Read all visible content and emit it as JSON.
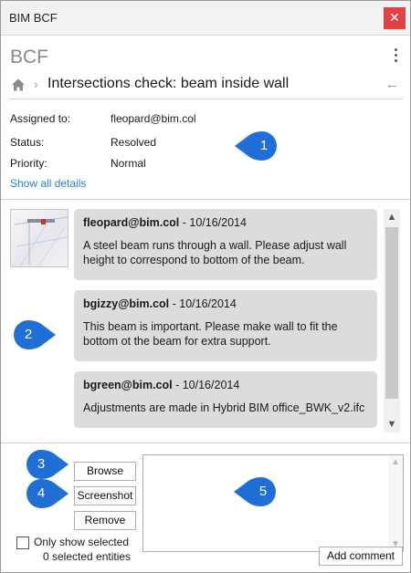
{
  "window": {
    "title": "BIM BCF",
    "close_glyph": "✕"
  },
  "header": {
    "app_name": "BCF"
  },
  "nav": {
    "title": "Intersections check: beam inside wall",
    "chevron": "›",
    "back_glyph": "←"
  },
  "details": {
    "assigned_label": "Assigned to:",
    "assigned_value": "fleopard@bim.col",
    "status_label": "Status:",
    "status_value": "Resolved",
    "priority_label": "Priority:",
    "priority_value": "Normal",
    "show_all": "Show all details"
  },
  "comments": [
    {
      "author": "fleopard@bim.col",
      "date": " - 10/16/2014",
      "text": "A steel beam runs through a wall. Please adjust wall height to correspond to bottom of the beam."
    },
    {
      "author": "bgizzy@bim.col",
      "date": " - 10/16/2014",
      "text": "This beam is important. Please make wall to fit the bottom ot the beam for extra support."
    },
    {
      "author": "bgreen@bim.col",
      "date": " - 10/16/2014",
      "text": "Adjustments are made in Hybrid BIM office_BWK_v2.ifc"
    }
  ],
  "callouts": [
    "1",
    "2",
    "3",
    "4",
    "5"
  ],
  "buttons": {
    "browse": "Browse",
    "screenshot": "Screenshot",
    "remove": "Remove",
    "add_comment": "Add comment"
  },
  "selection": {
    "only_show_selected": "Only show selected",
    "selected_entities": "0 selected entities"
  },
  "scroll_glyphs": {
    "up": "▲",
    "down": "▼"
  },
  "colors": {
    "callout": "#1f6fd6",
    "link": "#2b7fd6",
    "close": "#e04343",
    "bubble": "#dcdcdc"
  }
}
